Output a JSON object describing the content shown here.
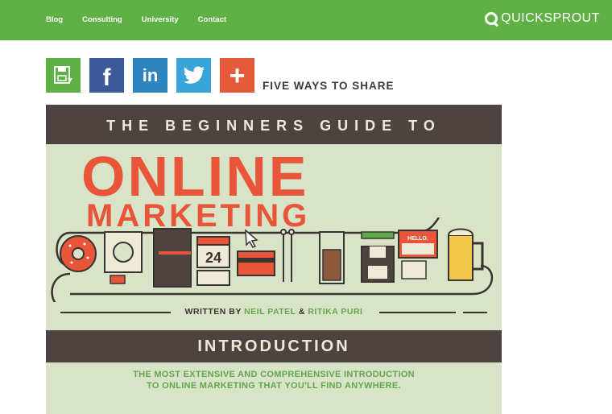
{
  "header": {
    "nav": [
      "Blog",
      "Consulting",
      "University",
      "Contact"
    ],
    "logo_text": "QUICKSPROUT",
    "logo_icon": "q-logo-icon"
  },
  "share": {
    "buttons": [
      {
        "name": "save-icon",
        "color": "#5fb146"
      },
      {
        "name": "facebook-icon",
        "color": "#3b5998",
        "glyph": "f"
      },
      {
        "name": "linkedin-icon",
        "color": "#2e84bf",
        "glyph": "in"
      },
      {
        "name": "twitter-icon",
        "color": "#38a4d8"
      },
      {
        "name": "plus-icon",
        "color": "#e45a3a",
        "glyph": "+"
      }
    ],
    "label": "FIVE WAYS TO SHARE"
  },
  "infographic": {
    "top_title": "THE BEGINNERS GUIDE TO",
    "title_line1": "ONLINE",
    "title_line2": "MARKETING",
    "written_by": "WRITTEN BY",
    "author1": "NEIL PATEL",
    "amp": "&",
    "author2": "RITIKA PURI",
    "calendar_day": "24",
    "name_tag": "HELLO.",
    "section_title": "INTRODUCTION",
    "tagline_1": "THE MOST EXTENSIVE AND COMPREHENSIVE INTRODUCTION",
    "tagline_2": "TO ONLINE MARKETING THAT YOU'LL FIND ANYWHERE.",
    "colors": {
      "dark": "#4d4442",
      "bg": "#d9e3c8",
      "red": "#e85538",
      "green": "#5fa84a"
    }
  }
}
